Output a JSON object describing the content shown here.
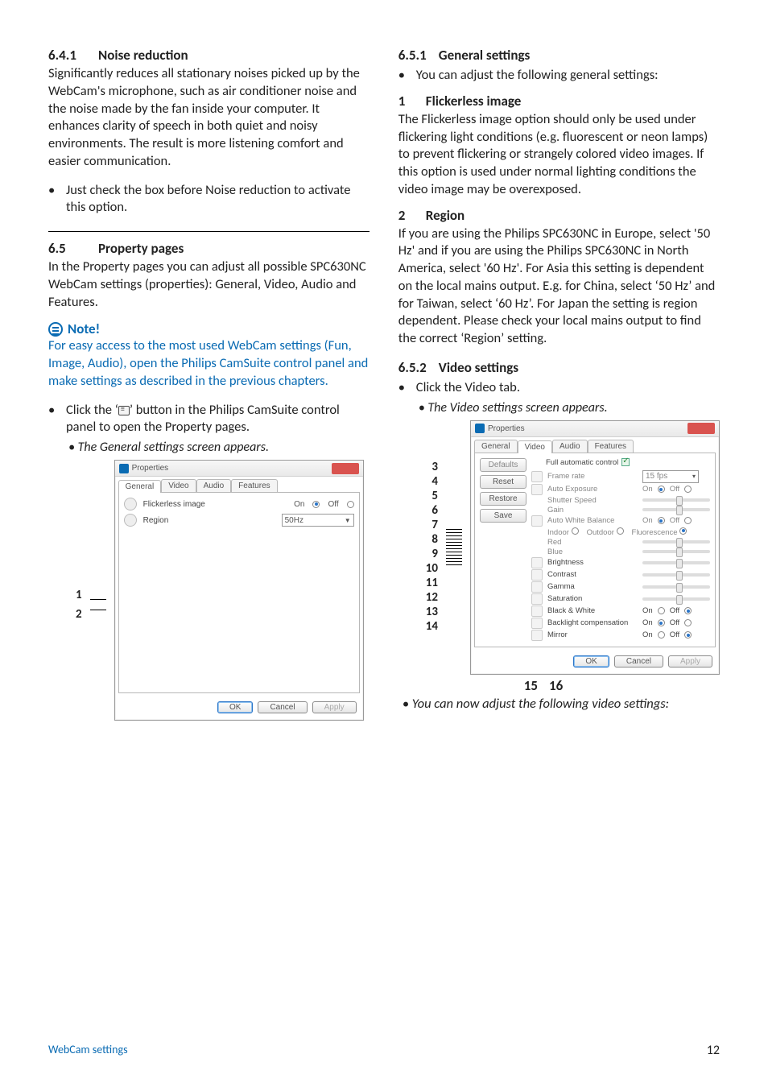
{
  "left": {
    "s641_head": "6.4.1",
    "s641_title": "Noise reduction",
    "s641_p1": "Significantly reduces all stationary noises picked up by the WebCam's microphone, such as air conditioner noise and the noise made by the fan inside your computer. It enhances clarity of speech in both quiet and noisy environments. The result is more listening comfort and easier communication.",
    "s641_bullet": "Just check the box before Noise reduction to activate this option.",
    "s65_head": "6.5",
    "s65_title": "Property pages",
    "s65_p1": "In the Property pages you can adjust all possible SPC630NC WebCam settings (properties): General, Video, Audio and  Features.",
    "note_label": "Note!",
    "note_body": "For easy access to the most used WebCam settings (Fun, Image,  Audio), open the Philips CamSuite control panel and make settings as described in the previous chapters.",
    "click_bullet_pre": "Click the ‘",
    "click_bullet_post": "’ button in the Philips CamSuite control panel to open the Property pages.",
    "click_result": "The General settings screen appears.",
    "callouts": [
      "1",
      "2"
    ],
    "dlg1": {
      "title": "Properties",
      "tabs": [
        "General",
        "Video",
        "Audio",
        "Features"
      ],
      "row1_label": "Flickerless image",
      "on": "On",
      "off": "Off",
      "row2_label": "Region",
      "region_value": "50Hz",
      "ok": "OK",
      "cancel": "Cancel",
      "apply": "Apply"
    }
  },
  "right": {
    "s651_head": "6.5.1",
    "s651_title": "General settings",
    "s651_bullet": "You can adjust the following general settings:",
    "i1_num": "1",
    "i1_title": "Flickerless image",
    "i1_p": "The Flickerless image option should only be used under flickering light conditions (e.g. fluorescent or neon lamps) to prevent flickering or strangely colored video images. If this option is used under normal lighting conditions the video image may be overexposed.",
    "i2_num": "2",
    "i2_title": "Region",
    "i2_p": "If you are using the Philips SPC630NC in Europe, select '50 Hz' and if you are using the Philips SPC630NC in North America, select '60 Hz'. For Asia this setting is dependent on the local mains output. E.g. for China, select ‘50 Hz’ and for Taiwan, select ‘60 Hz’. For Japan the setting is region dependent. Please check your local mains output to find the correct ‘Region’ setting.",
    "s652_head": "6.5.2",
    "s652_title": "Video settings",
    "s652_bullet": "Click the Video tab.",
    "s652_result": "The Video settings screen appears.",
    "callouts2": [
      "3",
      "4",
      "5",
      "6",
      "7",
      "8",
      "9",
      "10",
      "11",
      "12",
      "13",
      "14"
    ],
    "dlg2": {
      "title": "Properties",
      "tabs": [
        "General",
        "Video",
        "Audio",
        "Features"
      ],
      "defaults": "Defaults",
      "reset": "Reset",
      "restore": "Restore",
      "save": "Save",
      "full_auto": "Full automatic control",
      "frame_rate": "Frame rate",
      "frame_rate_val": "15 fps",
      "auto_exposure": "Auto Exposure",
      "shutter_speed": "Shutter Speed",
      "gain": "Gain",
      "auto_wb": "Auto White Balance",
      "indoor": "Indoor",
      "outdoor": "Outdoor",
      "fluor": "Fluorescence",
      "red": "Red",
      "blue": "Blue",
      "brightness": "Brightness",
      "contrast": "Contrast",
      "gamma": "Gamma",
      "saturation": "Saturation",
      "bw": "Black & White",
      "backlight": "Backlight compensation",
      "mirror": "Mirror",
      "on": "On",
      "off": "Off",
      "ok": "OK",
      "cancel": "Cancel",
      "apply": "Apply"
    },
    "bottom_nums": [
      "15",
      "16"
    ],
    "final_caption": "You can now adjust the following video settings:"
  },
  "footer": {
    "left": "WebCam settings",
    "page": "12"
  }
}
